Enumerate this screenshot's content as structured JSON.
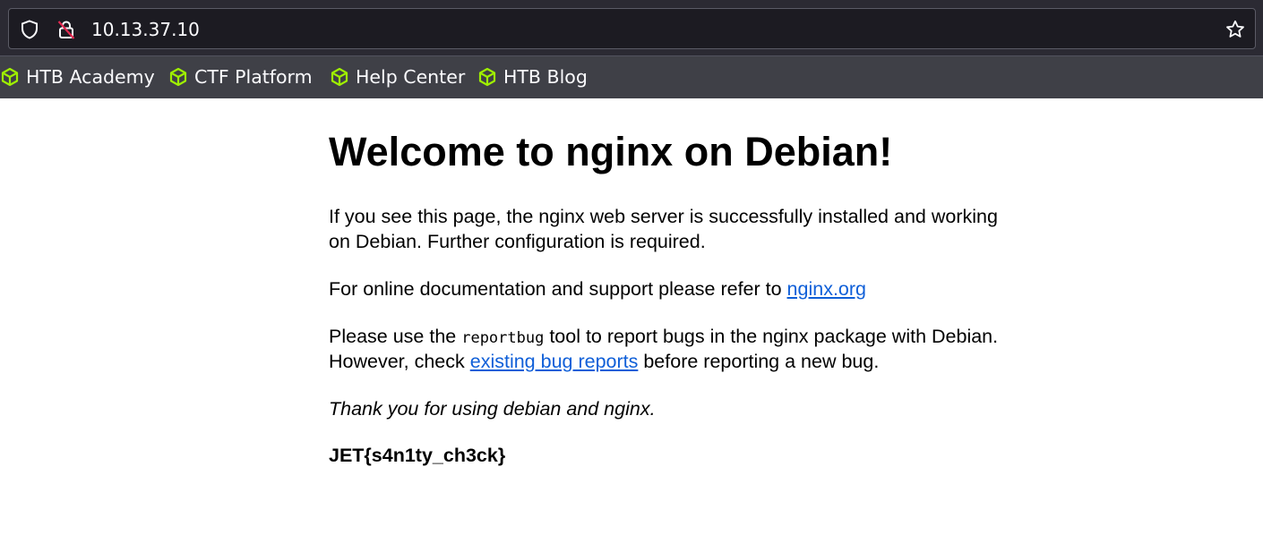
{
  "browser": {
    "url": "10.13.37.10",
    "bookmarks": [
      {
        "label": "HTB Academy"
      },
      {
        "label": "CTF Platform"
      },
      {
        "label": "Help Center"
      },
      {
        "label": "HTB Blog"
      }
    ],
    "colors": {
      "chrome": "#2b2a33",
      "bookmark_icon": "#9fef00"
    }
  },
  "page": {
    "title": "Welcome to nginx on Debian!",
    "p1_line1": "If you see this page, the nginx web server is successfully installed and working",
    "p1_line2": "on Debian. Further configuration is required.",
    "p2_text": "For online documentation and support please refer to ",
    "p2_link": "nginx.org",
    "p3_pre": "Please use the ",
    "p3_code": "reportbug",
    "p3_post": " tool to report bugs in the nginx package with Debian.",
    "p3_line2_pre": "However, check ",
    "p3_link": "existing bug reports",
    "p3_line2_post": " before reporting a new bug.",
    "thanks": "Thank you for using debian and nginx.",
    "flag": "JET{s4n1ty_ch3ck}",
    "colors": {
      "link": "#0f5fd8"
    }
  }
}
